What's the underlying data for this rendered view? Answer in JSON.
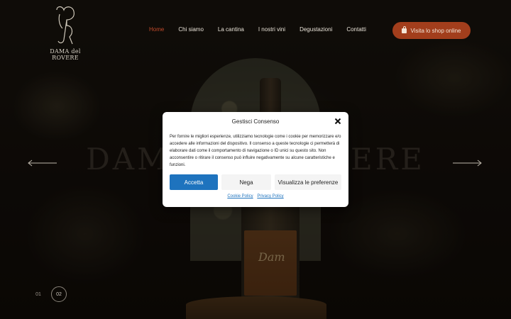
{
  "logo": {
    "text": "DAMA del ROVERE"
  },
  "nav": {
    "items": [
      {
        "label": "Home",
        "active": true
      },
      {
        "label": "Chi siamo"
      },
      {
        "label": "La cantina"
      },
      {
        "label": "I nostri vini"
      },
      {
        "label": "Degustazioni"
      },
      {
        "label": "Contatti"
      }
    ],
    "shop_label": "Visita lo shop online"
  },
  "hero": {
    "title": "DAMA del ROVERE",
    "bottle_label": "Dam"
  },
  "pager": {
    "items": [
      "01",
      "02"
    ],
    "active": "02"
  },
  "consent": {
    "title": "Gestisci Consenso",
    "body": "Per fornire le migliori esperienze, utilizziamo tecnologie come i cookie per memorizzare e/o accedere alle informazioni del dispositivo. Il consenso a queste tecnologie ci permetterà di elaborare dati come il comportamento di navigazione o ID unici su questo sito. Non acconsentire o ritirare il consenso può influire negativamente su alcune caratteristiche e funzioni.",
    "accept_label": "Accetta",
    "deny_label": "Nega",
    "prefs_label": "Visualizza le preferenze",
    "cookie_policy": "Cookie Policy",
    "privacy_policy": "Privacy Policy"
  },
  "colors": {
    "accent": "#a23e1c",
    "nav_active": "#c24a2b",
    "primary_button": "#1e73be"
  }
}
